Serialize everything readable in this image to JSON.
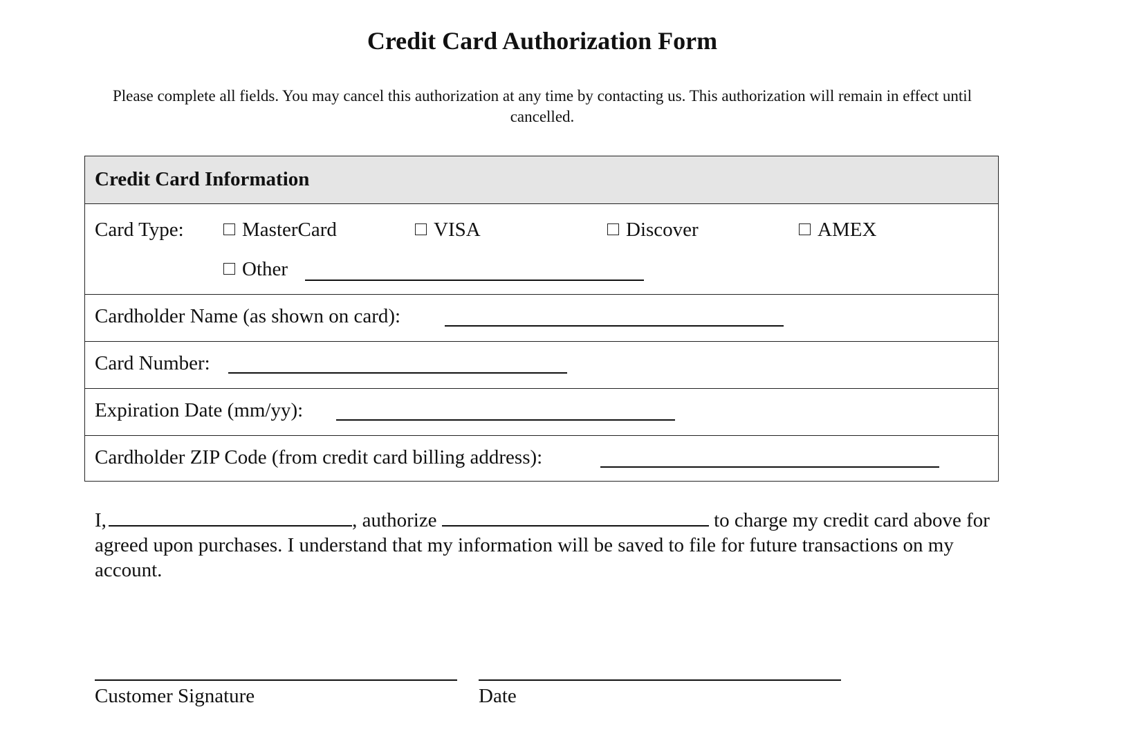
{
  "title": "Credit Card Authorization Form",
  "intro": "Please complete all fields. You may cancel this authorization at any time by contacting us. This authorization will remain in effect until cancelled.",
  "section": {
    "heading": "Credit Card Information",
    "card_type": {
      "label": "Card Type:",
      "options": [
        {
          "label": "MasterCard",
          "checked": false
        },
        {
          "label": "VISA",
          "checked": false
        },
        {
          "label": "Discover",
          "checked": false
        },
        {
          "label": "AMEX",
          "checked": false
        },
        {
          "label": "Other",
          "checked": false
        }
      ],
      "other_value": ""
    },
    "fields": [
      {
        "label": "Cardholder Name (as shown on card):",
        "value": ""
      },
      {
        "label": "Card Number:",
        "value": ""
      },
      {
        "label": "Expiration Date (mm/yy):",
        "value": ""
      },
      {
        "label": "Cardholder ZIP Code (from credit card billing address):",
        "value": ""
      }
    ]
  },
  "authorization": {
    "prefix": "I,",
    "middle": ", authorize",
    "suffix": "to charge my credit card",
    "rest": "above for agreed upon purchases. I understand that my information will be saved to file for future transactions on my account.",
    "name_value": "",
    "merchant_value": ""
  },
  "signature": {
    "signature_label": "Customer Signature",
    "date_label": "Date"
  }
}
